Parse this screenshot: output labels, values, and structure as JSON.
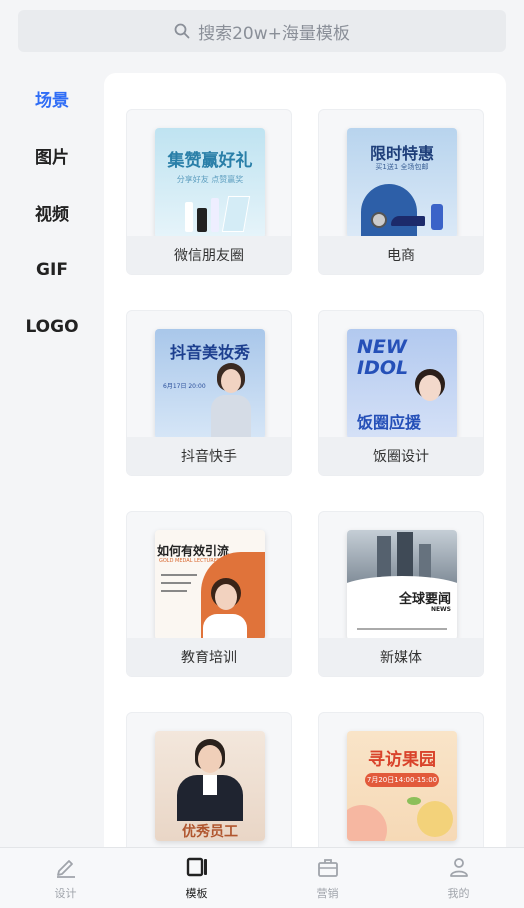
{
  "search": {
    "placeholder": "搜索20w+海量模板"
  },
  "sidebar": {
    "items": [
      {
        "label": "场景",
        "active": true
      },
      {
        "label": "图片"
      },
      {
        "label": "视频"
      },
      {
        "label": "GIF"
      },
      {
        "label": "LOGO"
      }
    ]
  },
  "cards": [
    {
      "label": "微信朋友圈",
      "thumb_title": "集赞赢好礼",
      "thumb_sub": "分享好友 点赞赢奖"
    },
    {
      "label": "电商",
      "thumb_title": "限时特惠",
      "thumb_sub": "买1送1 全场包邮"
    },
    {
      "label": "抖音快手",
      "thumb_title": "抖音美妆秀",
      "thumb_sub": "6月17日 20:00"
    },
    {
      "label": "饭圈设计",
      "thumb_title": "NEW IDOL",
      "thumb_sub": "饭圈应援"
    },
    {
      "label": "教育培训",
      "thumb_title": "如何有效引流",
      "thumb_sub": "GOLD MEDAL LECTURER"
    },
    {
      "label": "新媒体",
      "thumb_title": "全球要闻",
      "thumb_sub": "NEWS"
    },
    {
      "label": "",
      "thumb_title": "优秀员工",
      "thumb_sub": ""
    },
    {
      "label": "",
      "thumb_title": "寻访果园",
      "thumb_sub": "7月20日14:00-15:00"
    }
  ],
  "tabbar": {
    "items": [
      {
        "label": "设计",
        "icon": "pen-icon"
      },
      {
        "label": "模板",
        "icon": "template-icon",
        "active": true
      },
      {
        "label": "营销",
        "icon": "briefcase-icon"
      },
      {
        "label": "我的",
        "icon": "person-icon"
      }
    ]
  },
  "colors": {
    "accent": "#2f6df6",
    "background": "#f4f5f7"
  }
}
